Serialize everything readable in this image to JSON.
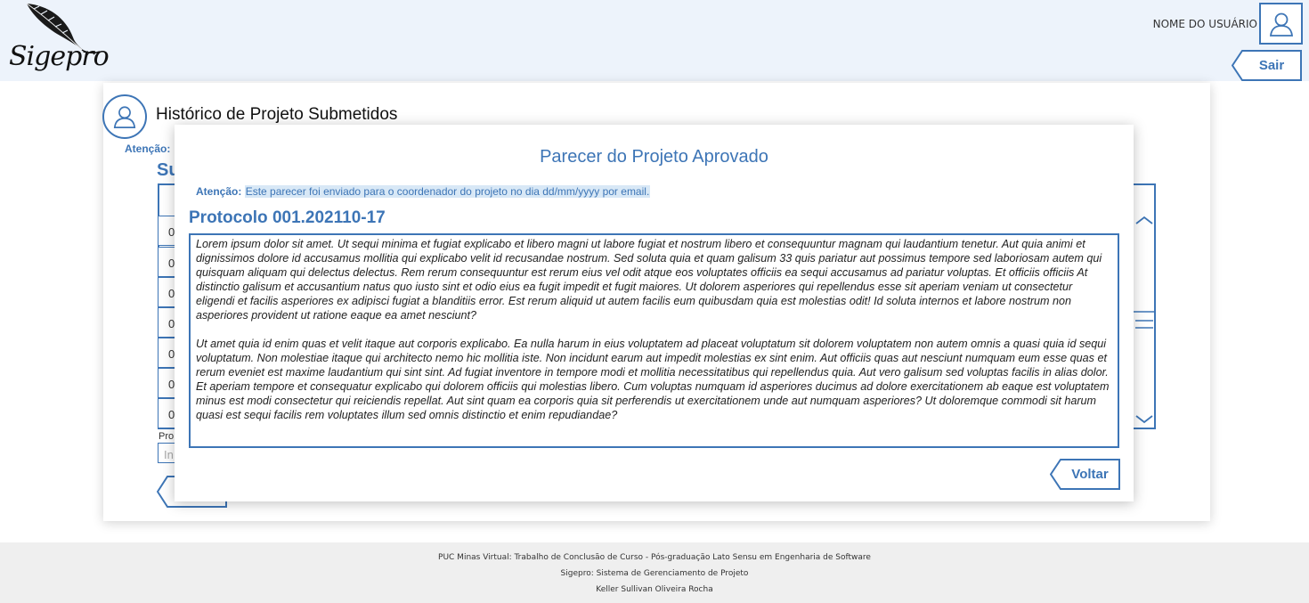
{
  "header": {
    "logo_text": "Sigepro",
    "user_name": "NOME DO USUÁRIO",
    "logout_label": "Sair"
  },
  "page": {
    "title": "Histórico de Projeto Submetidos",
    "attention_label": "Atenção:",
    "subtitle": "Su",
    "rows": [
      "0",
      "0",
      "0",
      "0",
      "0",
      "0",
      "0"
    ],
    "search_label": "Pro",
    "search_placeholder": "In"
  },
  "modal": {
    "title": "Parecer do Projeto Aprovado",
    "attention_label": "Atenção:",
    "attention_text": "Este parecer foi enviado para o coordenador do projeto no dia dd/mm/yyyy por email.",
    "protocol": "Protocolo 001.202110-17",
    "paragraphs": [
      "Lorem ipsum dolor sit amet. Ut sequi minima et fugiat explicabo et libero magni ut labore fugiat et nostrum libero et consequuntur magnam qui laudantium tenetur. Aut quia animi et dignissimos dolore id accusamus mollitia qui explicabo velit id recusandae nostrum. Sed soluta quia et quam galisum 33 quis pariatur aut possimus tempore sed laboriosam autem qui quisquam aliquam qui delectus delectus. Rem rerum consequuntur est rerum eius vel odit atque eos voluptates officiis ea sequi accusamus ad pariatur voluptas. Et officiis officiis At distinctio galisum et accusantium natus quo iusto sint et odio eius ea fugit impedit et fugit maiores. Ut dolorem asperiores qui repellendus esse sit aperiam veniam ut consectetur eligendi et facilis asperiores ex adipisci fugiat a blanditiis error. Est rerum aliquid ut autem facilis eum quibusdam quia est molestias odit! Id soluta internos et labore nostrum non asperiores provident ut ratione eaque ea amet nesciunt?",
      "Ut amet quia id enim quas et velit itaque aut corporis explicabo. Ea nulla harum in eius voluptatem ad placeat voluptatum sit dolorem voluptatem non autem omnis a quasi quia id sequi voluptatum. Non molestiae itaque qui architecto nemo hic mollitia iste. Non incidunt earum aut impedit molestias ex sint enim. Aut officiis quas aut nesciunt numquam eum esse quas et rerum eveniet est maxime laudantium qui sint sint. Ad fugiat inventore in tempore modi et mollitia necessitatibus qui repellendus quia. Aut vero galisum sed voluptas facilis in alias dolor. Et aperiam tempore et consequatur explicabo qui dolorem officiis qui molestias libero. Cum voluptas numquam id asperiores ducimus ad dolore exercitationem ab eaque est voluptatem minus est modi consectetur qui reiciendis repellat. Aut sint quam ea corporis quia sit perferendis ut exercitationem unde aut numquam asperiores? Ut doloremque commodi sit harum quasi est sequi facilis rem voluptates illum sed omnis distinctio et enim repudiandae?"
    ],
    "back_label": "Voltar"
  },
  "footer": {
    "line1": "PUC Minas Virtual: Trabalho de Conclusão de Curso - Pós-graduação Lato Sensu em Engenharia de Software",
    "line2": "Sigepro: Sistema de Gerenciamento de Projeto",
    "line3": "Keller Sullivan Oliveira Rocha"
  },
  "icons": {
    "logo": "quill-feather-icon",
    "user": "user-avatar-icon",
    "back": "arrow-tab-icon"
  },
  "colors": {
    "accent": "#3d75b6",
    "header_bg": "#edf3fb",
    "footer_bg": "#efefef",
    "highlight_bg": "#d8e8f6"
  }
}
